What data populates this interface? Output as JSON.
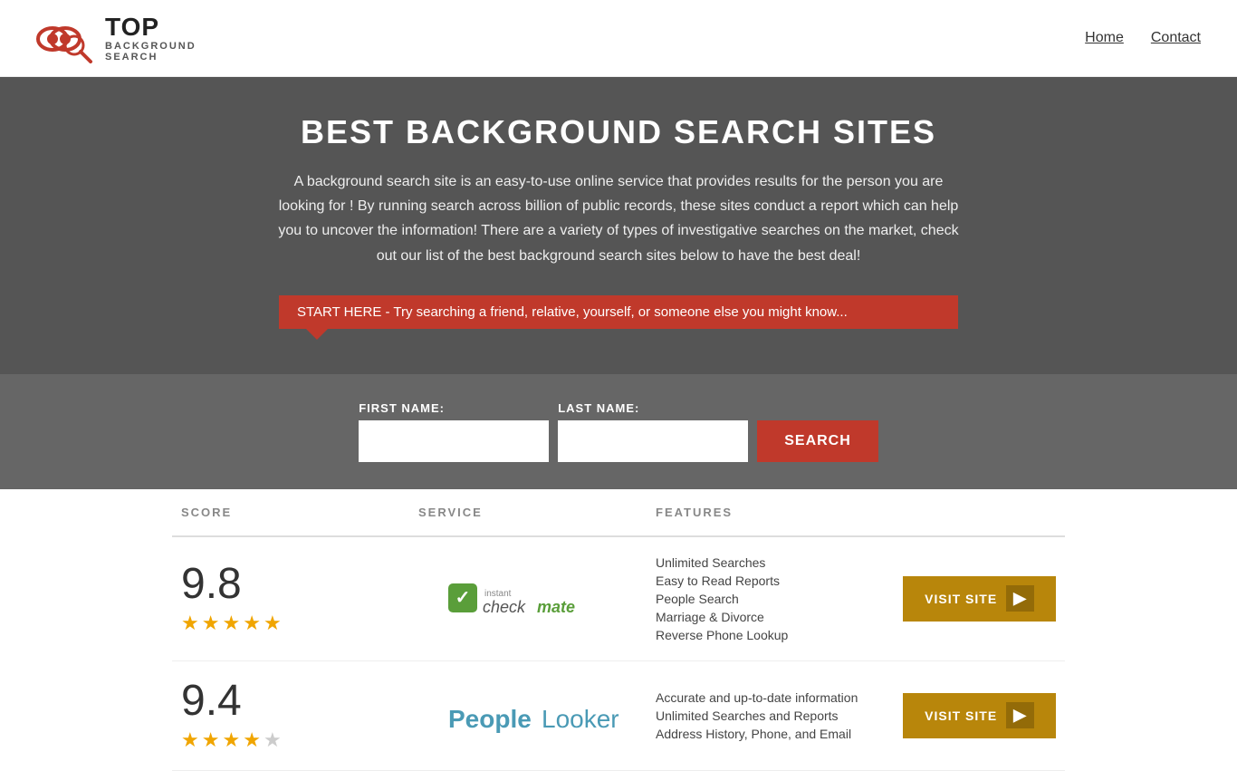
{
  "header": {
    "logo_top": "TOP",
    "logo_sub": "BACKGROUND\nSEARCH",
    "nav": {
      "home": "Home",
      "contact": "Contact"
    }
  },
  "hero": {
    "title": "BEST BACKGROUND SEARCH SITES",
    "description": "A background search site is an easy-to-use online service that provides results  for the person you are looking for ! By  running  search across billion of public records, these sites conduct  a report which can help you to uncover the information! There are a variety of types of investigative searches on the market, check out our  list of the best background search sites below to have the best deal!",
    "callout": "START HERE - Try searching a friend, relative, yourself, or someone else you might know...",
    "form": {
      "first_name_label": "FIRST NAME:",
      "last_name_label": "LAST NAME:",
      "search_button": "SEARCH"
    }
  },
  "table": {
    "headers": {
      "score": "SCORE",
      "service": "SERVICE",
      "features": "FEATURES",
      "action": ""
    },
    "rows": [
      {
        "score": "9.8",
        "stars": 4.5,
        "service_name": "Instant Checkmate",
        "features": [
          "Unlimited Searches",
          "Easy to Read Reports",
          "People Search",
          "Marriage & Divorce",
          "Reverse Phone Lookup"
        ],
        "visit_label": "VISIT SITE"
      },
      {
        "score": "9.4",
        "stars": 4,
        "service_name": "PeopleLooker",
        "features": [
          "Accurate and up-to-date information",
          "Unlimited Searches and Reports",
          "Address History, Phone, and Email"
        ],
        "visit_label": "VISIT SITE"
      }
    ]
  }
}
